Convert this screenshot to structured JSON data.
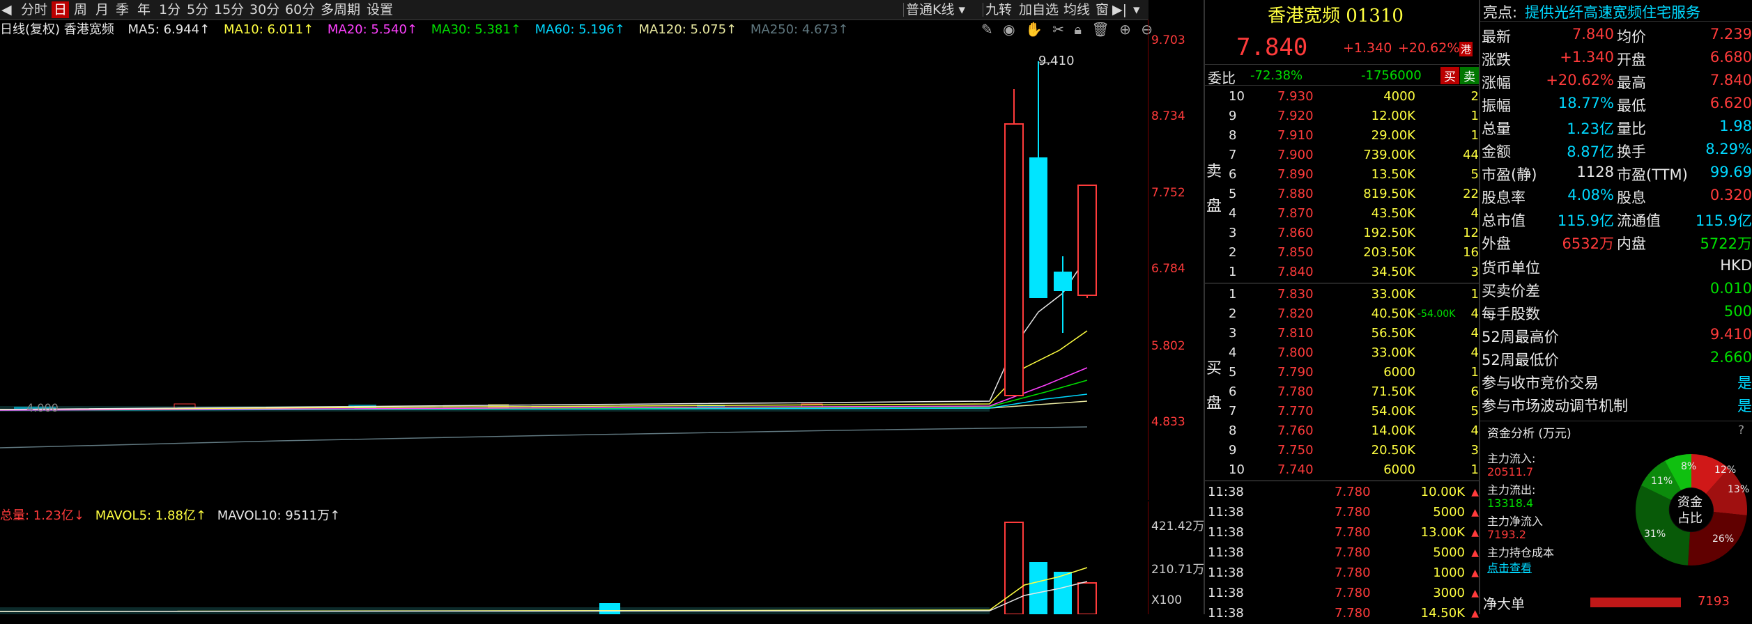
{
  "toolbar": {
    "items": [
      "分时",
      "日",
      "周",
      "月",
      "季",
      "年",
      "1分",
      "5分",
      "15分",
      "30分",
      "60分",
      "多周期",
      "设置"
    ],
    "kline_mode": "普通K线",
    "right_items": [
      "九转",
      "加自选",
      "均线",
      "窗"
    ]
  },
  "ma_line": {
    "prefix": "日线(复权) 香港宽频",
    "ma5": "MA5: 6.944↑",
    "ma10": "MA10: 6.011↑",
    "ma20": "MA20: 5.540↑",
    "ma30": "MA30: 5.381↑",
    "ma60": "MA60: 5.196↑",
    "ma120": "MA120: 5.075↑",
    "ma250": "MA250: 4.673↑"
  },
  "price_axis": [
    "9.703",
    "8.734",
    "7.752",
    "6.784",
    "5.802",
    "4.833"
  ],
  "high_label": "9.410",
  "low_label": "4.000",
  "volume": {
    "total": "总量: 1.23亿↓",
    "mavol5": "MAVOL5: 1.88亿↑",
    "mavol10": "MAVOL10: 9511万↑",
    "axis": [
      "421.42万",
      "210.71万",
      "X100"
    ]
  },
  "quote": {
    "title": "香港宽频 01310",
    "price": "7.840",
    "change": "+1.340",
    "change_pct": "+20.62%",
    "badge": "港",
    "weibi_label": "委比",
    "weibi_pct": "-72.38%",
    "weicha": "-1756000",
    "buy_btn": "买",
    "sell_btn": "卖",
    "sell_label": "卖盘",
    "buy_label": "买盘",
    "asks": [
      {
        "lvl": "10",
        "price": "7.930",
        "vol": "4000",
        "cnt": "2"
      },
      {
        "lvl": "9",
        "price": "7.920",
        "vol": "12.00K",
        "cnt": "1"
      },
      {
        "lvl": "8",
        "price": "7.910",
        "vol": "29.00K",
        "cnt": "1"
      },
      {
        "lvl": "7",
        "price": "7.900",
        "vol": "739.00K",
        "cnt": "44"
      },
      {
        "lvl": "6",
        "price": "7.890",
        "vol": "13.50K",
        "cnt": "5"
      },
      {
        "lvl": "5",
        "price": "7.880",
        "vol": "819.50K",
        "cnt": "22"
      },
      {
        "lvl": "4",
        "price": "7.870",
        "vol": "43.50K",
        "cnt": "4"
      },
      {
        "lvl": "3",
        "price": "7.860",
        "vol": "192.50K",
        "cnt": "12"
      },
      {
        "lvl": "2",
        "price": "7.850",
        "vol": "203.50K",
        "cnt": "16"
      },
      {
        "lvl": "1",
        "price": "7.840",
        "vol": "34.50K",
        "cnt": "3"
      }
    ],
    "bids": [
      {
        "lvl": "1",
        "price": "7.830",
        "vol": "33.00K",
        "cnt": "1",
        "extra": ""
      },
      {
        "lvl": "2",
        "price": "7.820",
        "vol": "40.50K",
        "cnt": "4",
        "extra": "-54.00K"
      },
      {
        "lvl": "3",
        "price": "7.810",
        "vol": "56.50K",
        "cnt": "4",
        "extra": ""
      },
      {
        "lvl": "4",
        "price": "7.800",
        "vol": "33.00K",
        "cnt": "4",
        "extra": ""
      },
      {
        "lvl": "5",
        "price": "7.790",
        "vol": "6000",
        "cnt": "1",
        "extra": ""
      },
      {
        "lvl": "6",
        "price": "7.780",
        "vol": "71.50K",
        "cnt": "6",
        "extra": ""
      },
      {
        "lvl": "7",
        "price": "7.770",
        "vol": "54.00K",
        "cnt": "5",
        "extra": ""
      },
      {
        "lvl": "8",
        "price": "7.760",
        "vol": "14.00K",
        "cnt": "4",
        "extra": ""
      },
      {
        "lvl": "9",
        "price": "7.750",
        "vol": "20.50K",
        "cnt": "3",
        "extra": ""
      },
      {
        "lvl": "10",
        "price": "7.740",
        "vol": "6000",
        "cnt": "1",
        "extra": ""
      }
    ],
    "ticks": [
      {
        "time": "11:38",
        "price": "7.780",
        "vol": "10.00K"
      },
      {
        "time": "11:38",
        "price": "7.780",
        "vol": "5000"
      },
      {
        "time": "11:38",
        "price": "7.780",
        "vol": "13.00K"
      },
      {
        "time": "11:38",
        "price": "7.780",
        "vol": "5000"
      },
      {
        "time": "11:38",
        "price": "7.780",
        "vol": "1000"
      },
      {
        "time": "11:38",
        "price": "7.780",
        "vol": "3000"
      },
      {
        "time": "11:38",
        "price": "7.780",
        "vol": "14.50K"
      }
    ]
  },
  "info": {
    "highlight_label": "亮点:",
    "highlight_text": "提供光纤高速宽频住宅服务",
    "rows": [
      {
        "l1": "最新",
        "v1": "7.840",
        "l2": "均价",
        "v2": "7.239"
      },
      {
        "l1": "涨跌",
        "v1": "+1.340",
        "l2": "开盘",
        "v2": "6.680"
      },
      {
        "l1": "涨幅",
        "v1": "+20.62%",
        "l2": "最高",
        "v2": "7.840"
      },
      {
        "l1": "振幅",
        "v1": "18.77%",
        "l2": "最低",
        "v2": "6.620"
      },
      {
        "l1": "总量",
        "v1": "1.23亿",
        "l2": "量比",
        "v2": "1.98"
      },
      {
        "l1": "金额",
        "v1": "8.87亿",
        "l2": "换手",
        "v2": "8.29%"
      },
      {
        "l1": "市盈(静)",
        "v1": "1128",
        "l2": "市盈(TTM)",
        "v2": "99.69"
      },
      {
        "l1": "股息率",
        "v1": "4.08%",
        "l2": "股息",
        "v2": "0.320"
      },
      {
        "l1": "总市值",
        "v1": "115.9亿",
        "l2": "流通值",
        "v2": "115.9亿"
      },
      {
        "l1": "外盘",
        "v1": "6532万",
        "l2": "内盘",
        "v2": "5722万"
      }
    ],
    "rows2": [
      {
        "l": "货币单位",
        "v": "HKD"
      },
      {
        "l": "买卖价差",
        "v": "0.010"
      },
      {
        "l": "每手股数",
        "v": "500"
      },
      {
        "l": "52周最高价",
        "v": "9.410"
      },
      {
        "l": "52周最低价",
        "v": "2.660"
      },
      {
        "l": "参与收市竞价交易",
        "v": "是"
      },
      {
        "l": "参与市场波动调节机制",
        "v": "是"
      }
    ],
    "fund_title": "资金分析 (万元)",
    "fund_q": "?",
    "main_in_label": "主力流入:",
    "main_in": "20511.7",
    "main_out_label": "主力流出:",
    "main_out": "13318.4",
    "main_net_label": "主力净流入",
    "main_net": "7193.2",
    "main_cost_label": "主力持仓成本",
    "check_link": "点击查看",
    "donut_center": "资金\n占比",
    "donut_center_1": "资金",
    "donut_center_2": "占比",
    "donut_pcts": [
      "8%",
      "12%",
      "13%",
      "26%",
      "31%",
      "11%"
    ],
    "net_big_label": "净大单",
    "net_big_value": "7193"
  },
  "colors": {
    "up": "#ff3b3b",
    "down": "#00e5ff",
    "ma5": "#e8e8e8",
    "ma10": "#ffff40",
    "ma20": "#ff40ff",
    "ma30": "#00e000",
    "ma60": "#00d8ff",
    "ma120": "#e8e8a0",
    "ma250": "#607880"
  }
}
